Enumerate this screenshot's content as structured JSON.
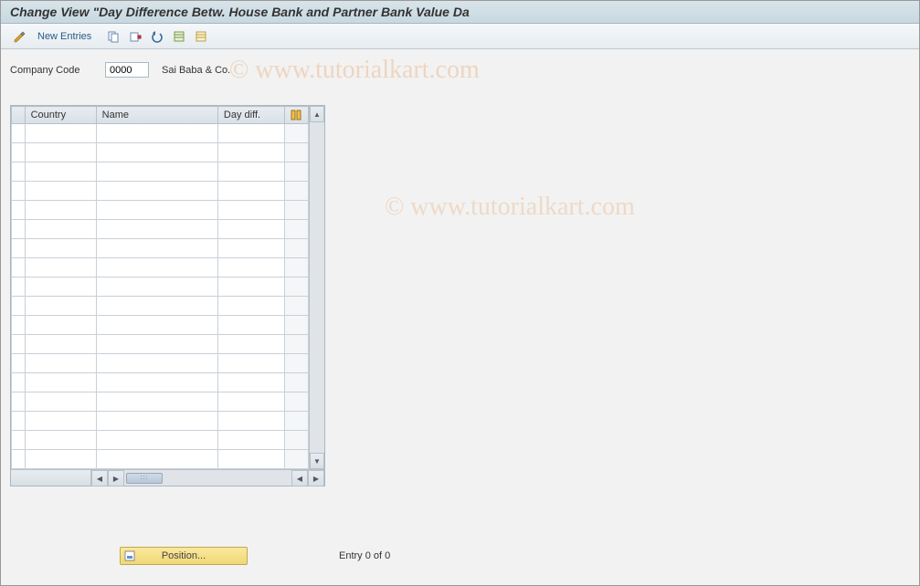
{
  "title": "Change View \"Day Difference Betw. House Bank and Partner Bank Value Da",
  "toolbar": {
    "new_entries_label": "New Entries"
  },
  "fields": {
    "company_code_label": "Company Code",
    "company_code_value": "0000",
    "company_name": "Sai Baba & Co."
  },
  "table": {
    "columns": {
      "country": "Country",
      "name": "Name",
      "daydiff": "Day diff."
    },
    "row_count": 18
  },
  "footer": {
    "position_label": "Position...",
    "entry_text": "Entry 0 of 0"
  },
  "watermark": {
    "a": "©  www.tutorialkart.com",
    "b": "©  www.tutorialkart.com"
  }
}
